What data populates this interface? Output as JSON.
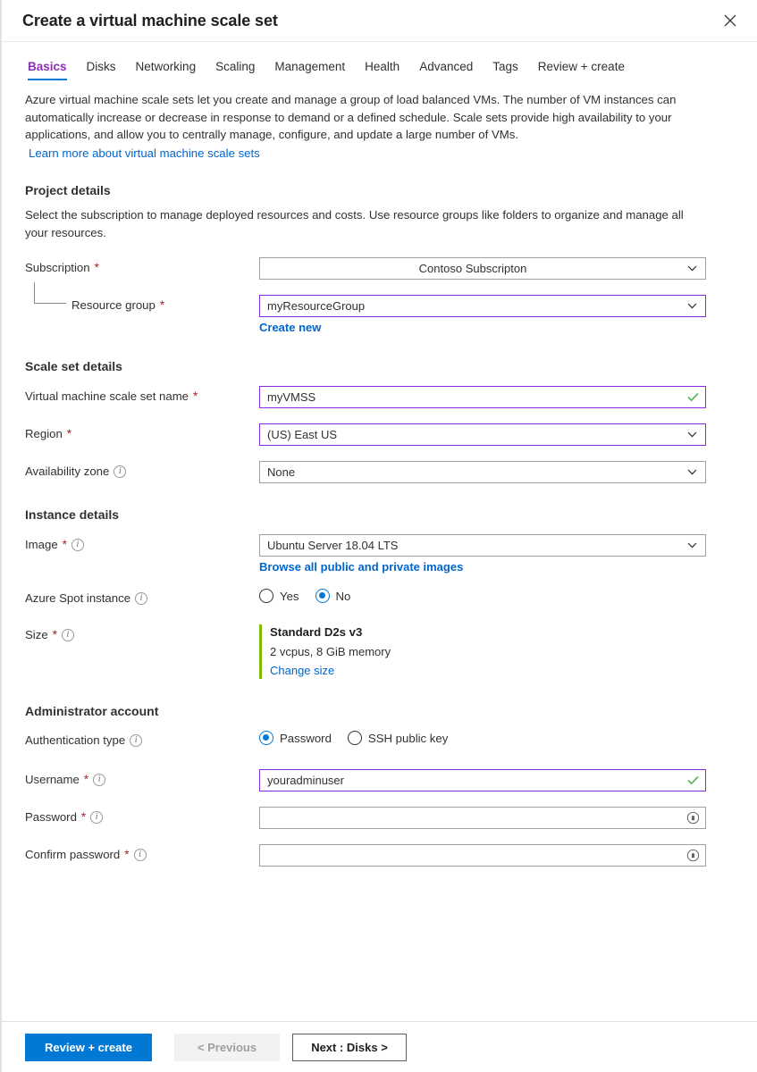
{
  "window": {
    "title": "Create a virtual machine scale set",
    "close_icon": "close-icon"
  },
  "tabs": [
    {
      "label": "Basics",
      "active": true
    },
    {
      "label": "Disks",
      "active": false
    },
    {
      "label": "Networking",
      "active": false
    },
    {
      "label": "Scaling",
      "active": false
    },
    {
      "label": "Management",
      "active": false
    },
    {
      "label": "Health",
      "active": false
    },
    {
      "label": "Advanced",
      "active": false
    },
    {
      "label": "Tags",
      "active": false
    },
    {
      "label": "Review + create",
      "active": false
    }
  ],
  "intro": {
    "text": "Azure virtual machine scale sets let you create and manage a group of load balanced VMs. The number of VM instances can automatically increase or decrease in response to demand or a defined schedule. Scale sets provide high availability to your applications, and allow you to centrally manage, configure, and update a large number of VMs.",
    "link": "Learn more about virtual machine scale sets"
  },
  "project_details": {
    "heading": "Project details",
    "description": "Select the subscription to manage deployed resources and costs. Use resource groups like folders to organize and manage all your resources.",
    "subscription": {
      "label": "Subscription",
      "value": "Contoso Subscripton"
    },
    "resource_group": {
      "label": "Resource group",
      "value": "myResourceGroup",
      "create_new_link": "Create new"
    }
  },
  "scale_set_details": {
    "heading": "Scale set details",
    "name": {
      "label": "Virtual machine scale set name",
      "value": "myVMSS"
    },
    "region": {
      "label": "Region",
      "value": "(US) East US"
    },
    "availability_zone": {
      "label": "Availability zone",
      "value": "None"
    }
  },
  "instance_details": {
    "heading": "Instance details",
    "image": {
      "label": "Image",
      "value": "Ubuntu Server 18.04 LTS",
      "browse_link": "Browse all public and private images"
    },
    "spot_instance": {
      "label": "Azure Spot instance",
      "options": [
        {
          "label": "Yes",
          "selected": false
        },
        {
          "label": "No",
          "selected": true
        }
      ]
    },
    "size": {
      "label": "Size",
      "name": "Standard D2s v3",
      "specs": "2 vcpus, 8 GiB memory",
      "change_link": "Change size",
      "accent_color": "#7fba00"
    }
  },
  "administrator_account": {
    "heading": "Administrator account",
    "authentication_type": {
      "label": "Authentication type",
      "options": [
        {
          "label": "Password",
          "selected": true
        },
        {
          "label": "SSH public key",
          "selected": false
        }
      ]
    },
    "username": {
      "label": "Username",
      "value": "youradminuser"
    },
    "password": {
      "label": "Password",
      "value": ""
    },
    "confirm_password": {
      "label": "Confirm password",
      "value": ""
    }
  },
  "footer": {
    "review_create": "Review + create",
    "previous": "< Previous",
    "next": "Next : Disks >"
  },
  "colors": {
    "accent_blue": "#0078d4",
    "tab_active": "#8b2fb8",
    "link": "#0066cc",
    "required": "#a4262c",
    "field_focus": "#8a2be2",
    "valid_check": "#5ab55a"
  }
}
